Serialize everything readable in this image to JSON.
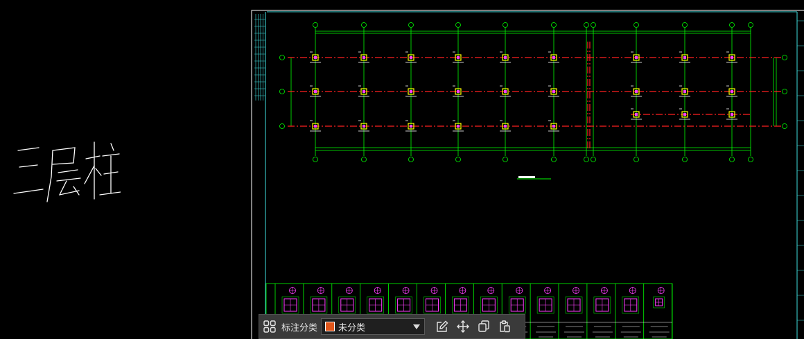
{
  "drawing": {
    "handwritten_title": "三层柱",
    "axis_bubble_color": "#00ff00",
    "grid_line_color": "#ff2020",
    "beam_line_color": "#00ff00",
    "frame_color": "#40e0e0",
    "column_color": "#ffff00",
    "rebar_color": "#ff40ff"
  },
  "toolbar": {
    "grid_icon": "grid-4-icon",
    "category_label": "标注分类",
    "category_value": "未分类",
    "category_swatch": "#e0561b",
    "edit_icon": "edit-icon",
    "move_icon": "move-icon",
    "copy_icon": "copy-icon",
    "paste_icon": "paste-icon"
  }
}
